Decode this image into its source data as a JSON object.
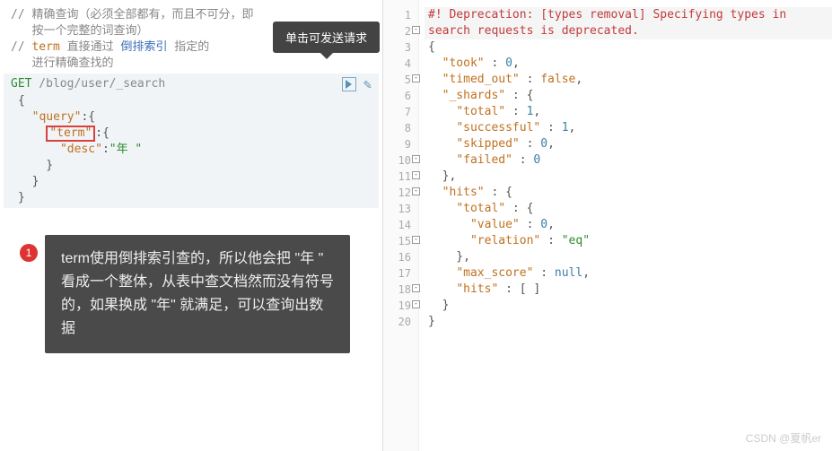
{
  "left": {
    "comment1a": "// 精确查询（必须全部都有，而且不可分，即",
    "comment1b": "   按一个完整的词查询）",
    "comment2a_prefix": "// ",
    "comment2a_term": "term",
    "comment2a_mid": " 直接通过 ",
    "comment2a_blue": "倒排索引",
    "comment2a_suffix": " 指定的",
    "comment2b": "   进行精确查找的",
    "method": "GET",
    "path": " /blog/user/_search",
    "body": {
      "l1": "{",
      "l2_indent": "  ",
      "l2_key": "\"query\"",
      "l2_after": ":{",
      "l3_indent": "    ",
      "l3_key": "\"term\"",
      "l3_after": ":{",
      "l4_indent": "      ",
      "l4_key": "\"desc\"",
      "l4_sep": ":",
      "l4_val": "\"年 \"",
      "l5": "    }",
      "l6": "  }",
      "l7": "}"
    }
  },
  "tooltip": "单击可发送请求",
  "annotation": {
    "num": "1",
    "text": "term使用倒排索引查的，所以他会把 \"年  \" 看成一个整体，从表中查文档然而没有符号的，如果换成 \"年\" 就满足，可以查询出数据"
  },
  "output": {
    "lines": [
      {
        "n": 1,
        "type": "deprec",
        "text": "#! Deprecation: [types removal] Specifying types in search requests is deprecated."
      },
      {
        "n": 2,
        "raw": [
          {
            "t": "{",
            "c": "punct"
          }
        ],
        "fold": true
      },
      {
        "n": 3,
        "raw": [
          {
            "t": "  ",
            "c": ""
          },
          {
            "t": "\"took\"",
            "c": "string-key"
          },
          {
            "t": " : ",
            "c": "punct"
          },
          {
            "t": "0",
            "c": "num"
          },
          {
            "t": ",",
            "c": "punct"
          }
        ]
      },
      {
        "n": 4,
        "raw": [
          {
            "t": "  ",
            "c": ""
          },
          {
            "t": "\"timed_out\"",
            "c": "string-key"
          },
          {
            "t": " : ",
            "c": "punct"
          },
          {
            "t": "false",
            "c": "bool"
          },
          {
            "t": ",",
            "c": "punct"
          }
        ]
      },
      {
        "n": 5,
        "raw": [
          {
            "t": "  ",
            "c": ""
          },
          {
            "t": "\"_shards\"",
            "c": "string-key"
          },
          {
            "t": " : {",
            "c": "punct"
          }
        ],
        "fold": true
      },
      {
        "n": 6,
        "raw": [
          {
            "t": "    ",
            "c": ""
          },
          {
            "t": "\"total\"",
            "c": "string-key"
          },
          {
            "t": " : ",
            "c": "punct"
          },
          {
            "t": "1",
            "c": "num"
          },
          {
            "t": ",",
            "c": "punct"
          }
        ]
      },
      {
        "n": 7,
        "raw": [
          {
            "t": "    ",
            "c": ""
          },
          {
            "t": "\"successful\"",
            "c": "string-key"
          },
          {
            "t": " : ",
            "c": "punct"
          },
          {
            "t": "1",
            "c": "num"
          },
          {
            "t": ",",
            "c": "punct"
          }
        ]
      },
      {
        "n": 8,
        "raw": [
          {
            "t": "    ",
            "c": ""
          },
          {
            "t": "\"skipped\"",
            "c": "string-key"
          },
          {
            "t": " : ",
            "c": "punct"
          },
          {
            "t": "0",
            "c": "num"
          },
          {
            "t": ",",
            "c": "punct"
          }
        ]
      },
      {
        "n": 9,
        "raw": [
          {
            "t": "    ",
            "c": ""
          },
          {
            "t": "\"failed\"",
            "c": "string-key"
          },
          {
            "t": " : ",
            "c": "punct"
          },
          {
            "t": "0",
            "c": "num"
          }
        ]
      },
      {
        "n": 10,
        "raw": [
          {
            "t": "  },",
            "c": "punct"
          }
        ],
        "fold": true
      },
      {
        "n": 11,
        "raw": [
          {
            "t": "  ",
            "c": ""
          },
          {
            "t": "\"hits\"",
            "c": "string-key"
          },
          {
            "t": " : {",
            "c": "punct"
          }
        ],
        "fold": true
      },
      {
        "n": 12,
        "raw": [
          {
            "t": "    ",
            "c": ""
          },
          {
            "t": "\"total\"",
            "c": "string-key"
          },
          {
            "t": " : {",
            "c": "punct"
          }
        ],
        "fold": true
      },
      {
        "n": 13,
        "raw": [
          {
            "t": "      ",
            "c": ""
          },
          {
            "t": "\"value\"",
            "c": "string-key"
          },
          {
            "t": " : ",
            "c": "punct"
          },
          {
            "t": "0",
            "c": "num"
          },
          {
            "t": ",",
            "c": "punct"
          }
        ]
      },
      {
        "n": 14,
        "raw": [
          {
            "t": "      ",
            "c": ""
          },
          {
            "t": "\"relation\"",
            "c": "string-key"
          },
          {
            "t": " : ",
            "c": "punct"
          },
          {
            "t": "\"eq\"",
            "c": "string-val"
          }
        ]
      },
      {
        "n": 15,
        "raw": [
          {
            "t": "    },",
            "c": "punct"
          }
        ],
        "fold": true
      },
      {
        "n": 16,
        "raw": [
          {
            "t": "    ",
            "c": ""
          },
          {
            "t": "\"max_score\"",
            "c": "string-key"
          },
          {
            "t": " : ",
            "c": "punct"
          },
          {
            "t": "null",
            "c": "null"
          },
          {
            "t": ",",
            "c": "punct"
          }
        ]
      },
      {
        "n": 17,
        "raw": [
          {
            "t": "    ",
            "c": ""
          },
          {
            "t": "\"hits\"",
            "c": "string-key"
          },
          {
            "t": " : [ ]",
            "c": "punct"
          }
        ]
      },
      {
        "n": 18,
        "raw": [
          {
            "t": "  }",
            "c": "punct"
          }
        ],
        "fold": true
      },
      {
        "n": 19,
        "raw": [
          {
            "t": "}",
            "c": "punct"
          }
        ],
        "fold": true
      },
      {
        "n": 20,
        "raw": []
      }
    ]
  },
  "watermark": "CSDN @夏帆er"
}
